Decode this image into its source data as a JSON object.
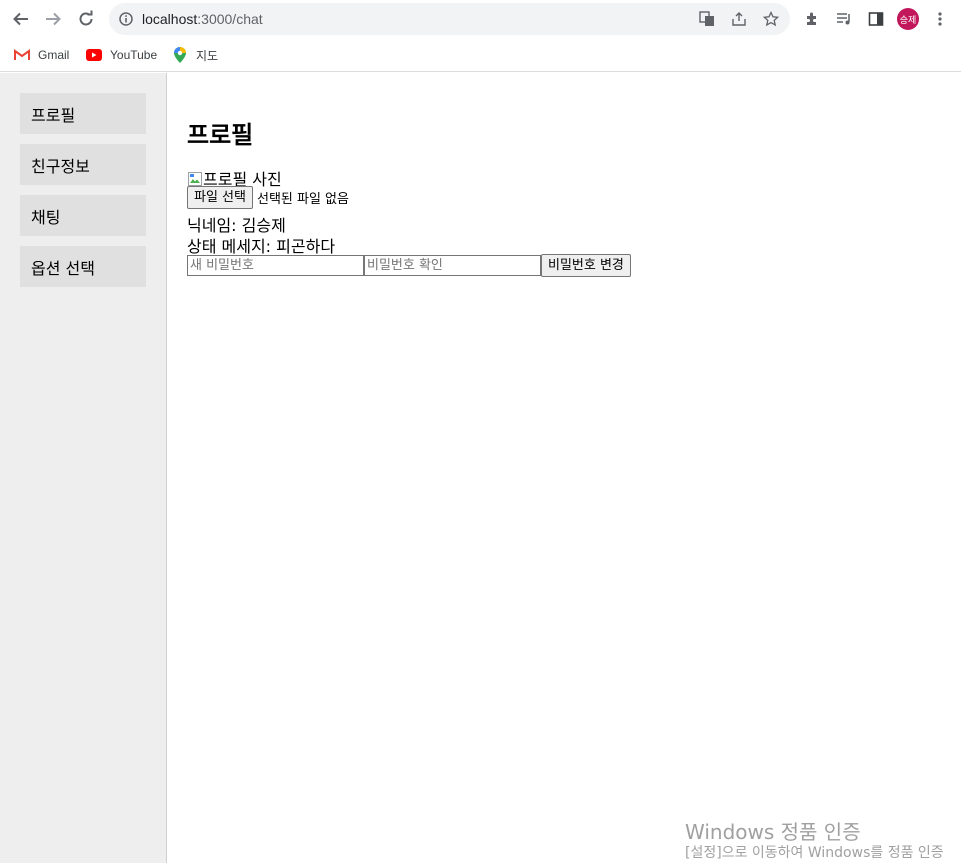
{
  "browser": {
    "url_host": "localhost",
    "url_port_path": ":3000/chat",
    "avatar_text": "승제",
    "bookmarks": [
      {
        "label": "Gmail",
        "icon": "gmail-icon"
      },
      {
        "label": "YouTube",
        "icon": "youtube-icon"
      },
      {
        "label": "지도",
        "icon": "maps-icon"
      }
    ]
  },
  "sidebar": {
    "items": [
      {
        "label": "프로필"
      },
      {
        "label": "친구정보"
      },
      {
        "label": "채팅"
      },
      {
        "label": "옵션 선택"
      }
    ]
  },
  "profile": {
    "title": "프로필",
    "photo_alt": "프로필 사진",
    "file_button": "파일 선택",
    "file_status": "선택된 파일 없음",
    "nickname": "닉네임: 김승제",
    "status_message": "상태 메세지: 피곤하다",
    "new_password_placeholder": "새 비밀번호",
    "confirm_password_placeholder": "비밀번호 확인",
    "change_password_button": "비밀번호 변경"
  },
  "watermark": {
    "line1": "Windows 정품 인증",
    "line2": "[설정]으로 이동하여 Windows를 정품 인증"
  }
}
